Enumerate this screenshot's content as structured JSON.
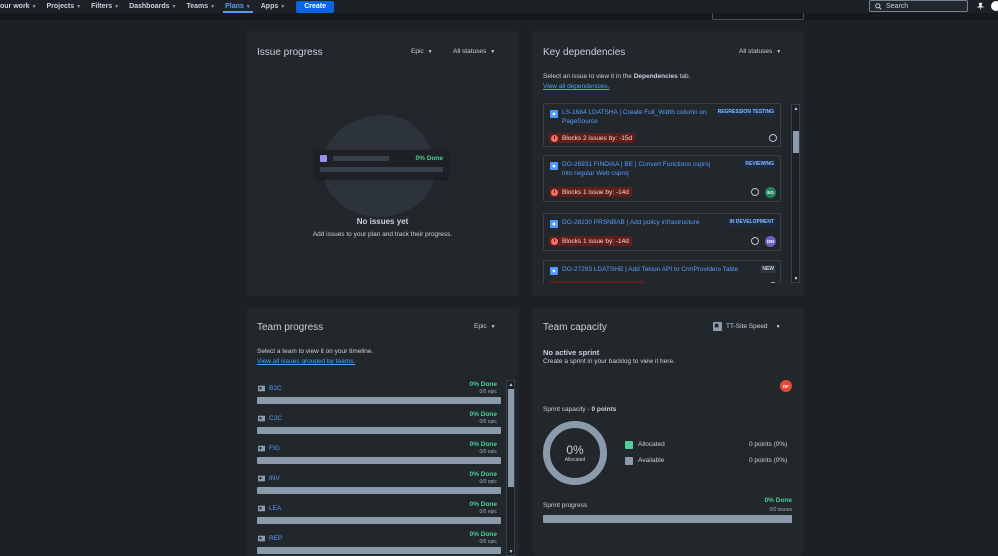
{
  "nav": {
    "items": [
      {
        "label": "our work",
        "active": false
      },
      {
        "label": "Projects",
        "active": false
      },
      {
        "label": "Filters",
        "active": false
      },
      {
        "label": "Dashboards",
        "active": false
      },
      {
        "label": "Teams",
        "active": false
      },
      {
        "label": "Plans",
        "active": true
      },
      {
        "label": "Apps",
        "active": false
      }
    ],
    "create_label": "Create",
    "search_placeholder": "Search"
  },
  "issue_progress": {
    "title": "Issue progress",
    "group_by": "Epic",
    "status_filter": "All statuses",
    "preview_done": "0% Done",
    "empty_title": "No issues yet",
    "empty_body": "Add issues to your plan and track their progress."
  },
  "key_dependencies": {
    "title": "Key dependencies",
    "status_filter": "All statuses",
    "intro_prefix": "Select an issue to view it in the ",
    "intro_bold": "Dependencies",
    "intro_suffix": " tab.",
    "view_all_link": "View all dependencies.",
    "items": [
      {
        "summary": "LS-1684 LDATSHA | Create Full_Width column on PageSource",
        "status": "REGRESSION TESTING",
        "blocks": "Blocks 2 issues by: -15d",
        "avatar": ""
      },
      {
        "summary": "DO-26931 FINDIAA | BE | Convert Functions csproj into regular Web csproj",
        "status": "REVIEWING",
        "blocks": "Blocks 1 issue by: -14d",
        "avatar": "EG"
      },
      {
        "summary": "DO-28230 PRSNBAB | Add policy infrastructure",
        "status": "IN DEVELOPMENT",
        "blocks": "Blocks 1 issue by: -14d",
        "avatar": "DM"
      },
      {
        "summary": "DO-27293 LDATSHB | Add Tekion API to CrmProviders Table",
        "status": "NEW",
        "blocks": "",
        "avatar": ""
      }
    ],
    "colors": {
      "avatar_eg": "#1f845a",
      "avatar_dm": "#6e5dc6"
    }
  },
  "team_progress": {
    "title": "Team progress",
    "group_by": "Epic",
    "intro": "Select a team to view it on your timeline.",
    "view_all_link": "View all issues grouped by teams.",
    "teams": [
      {
        "name": "B2C",
        "done": "0% Done",
        "epic": "0/0 epic"
      },
      {
        "name": "C2C",
        "done": "0% Done",
        "epic": "0/0 epic"
      },
      {
        "name": "FIG",
        "done": "0% Done",
        "epic": "0/0 epic"
      },
      {
        "name": "INV",
        "done": "0% Done",
        "epic": "0/0 epic"
      },
      {
        "name": "LEA",
        "done": "0% Done",
        "epic": "0/0 epic"
      },
      {
        "name": "REP",
        "done": "0% Done",
        "epic": "0/0 epic"
      }
    ]
  },
  "team_capacity": {
    "title": "Team capacity",
    "team_selector": "TT-Site Speed",
    "no_sprint_title": "No active sprint",
    "no_sprint_body": "Create a sprint in your backlog to view it here.",
    "avatar": "DF",
    "sprint_capacity_label": "Sprint capacity",
    "sprint_capacity_sep": "-",
    "sprint_capacity_points": "0 points",
    "ring_percent": "0%",
    "ring_label": "Allocated",
    "legend": [
      {
        "label": "Allocated",
        "value": "0 points (0%)",
        "color": "#4bce97"
      },
      {
        "label": "Available",
        "value": "0 points (0%)",
        "color": "#8c9bab"
      }
    ],
    "sprint_progress_label": "Sprint progress",
    "sprint_progress_done": "0% Done",
    "sprint_progress_issues": "0/0 issues"
  }
}
